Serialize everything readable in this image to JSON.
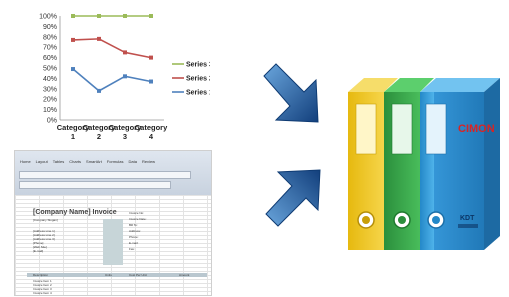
{
  "chart_data": {
    "type": "line",
    "categories": [
      "Category 1",
      "Category 2",
      "Category 3",
      "Category 4"
    ],
    "series": [
      {
        "name": "Series 1",
        "values": [
          0.49,
          0.28,
          0.42,
          0.37
        ],
        "color": "#4f81bd"
      },
      {
        "name": "Series 2",
        "values": [
          0.77,
          0.78,
          0.65,
          0.6
        ],
        "color": "#c0504d"
      },
      {
        "name": "Series 3",
        "values": [
          1.0,
          1.0,
          1.0,
          1.0
        ],
        "color": "#9bbb59"
      }
    ],
    "ylim": [
      0,
      1
    ],
    "yticks": [
      "0%",
      "10%",
      "20%",
      "30%",
      "40%",
      "50%",
      "60%",
      "70%",
      "80%",
      "90%",
      "100%"
    ],
    "grid": false,
    "legend": "right"
  },
  "spreadsheet": {
    "tabs": [
      "Home",
      "Layout",
      "Tables",
      "Charts",
      "SmartArt",
      "Formulas",
      "Data",
      "Review"
    ],
    "title": "[Company Name] Invoice",
    "header_cols": [
      "Description",
      "Units",
      "Cost Per Unit",
      "Amount"
    ],
    "company": "[Company Slogan]",
    "address_lines": [
      "[Address Line 1]",
      "[Address Line 2]",
      "[Address Line 3]",
      "[Phone]",
      "[Web Site]",
      "[E-mail]"
    ],
    "invoice_labels": [
      "Invoice No:",
      "Invoice Date:",
      "Bill To:",
      "Address:",
      "Phone:",
      "E-mail:",
      "Fax:"
    ],
    "items": [
      "Invoice Item 1",
      "Invoice Item 2",
      "Invoice Item 3",
      "Invoice Item 4"
    ]
  },
  "binders": {
    "colors": [
      "#f0c419",
      "#37a84a",
      "#2f9ad8"
    ],
    "spine_logo": "CIMON",
    "brand_label": "KDT"
  },
  "arrow_color": "#1c5fa8"
}
